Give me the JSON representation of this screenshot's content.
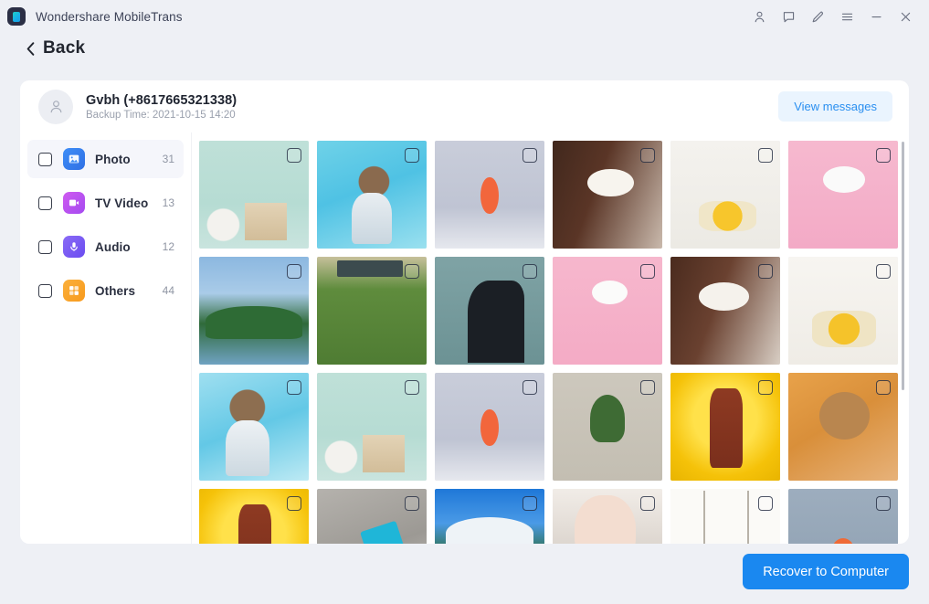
{
  "window": {
    "app_title": "Wondershare MobileTrans",
    "logo_icon": "wondershare-logo-icon",
    "controls": [
      {
        "name": "account-icon",
        "label": "Account"
      },
      {
        "name": "feedback-icon",
        "label": "Feedback"
      },
      {
        "name": "edit-icon",
        "label": "Edit"
      },
      {
        "name": "menu-icon",
        "label": "Menu"
      },
      {
        "name": "minimize-icon",
        "label": "Minimize"
      },
      {
        "name": "close-icon",
        "label": "Close"
      }
    ]
  },
  "nav": {
    "back_label": "Back",
    "back_icon": "chevron-left-icon"
  },
  "contact": {
    "avatar_icon": "person-icon",
    "name": "Gvbh (+8617665321338)",
    "backup_time": "Backup Time: 2021-10-15 14:20",
    "view_messages_label": "View messages"
  },
  "sidebar": {
    "items": [
      {
        "label": "Photo",
        "count": "31",
        "icon": "photo-icon",
        "icon_class": "photo",
        "active": true,
        "checked": false
      },
      {
        "label": "TV Video",
        "count": "13",
        "icon": "video-icon",
        "icon_class": "video",
        "active": false,
        "checked": false
      },
      {
        "label": "Audio",
        "count": "12",
        "icon": "audio-icon",
        "icon_class": "audio",
        "active": false,
        "checked": false
      },
      {
        "label": "Others",
        "count": "44",
        "icon": "others-icon",
        "icon_class": "others",
        "active": false,
        "checked": false
      }
    ]
  },
  "grid": {
    "columns": 6,
    "checkbox_icon": "checkbox-unchecked-icon",
    "tiles": [
      {
        "art": "a-room",
        "alt": "mint green room with chair and clock",
        "checked": false
      },
      {
        "art": "a-anime",
        "alt": "anime girl in water",
        "checked": false
      },
      {
        "art": "a-vase1",
        "alt": "orange flower in glass vase",
        "checked": false
      },
      {
        "art": "a-tulip",
        "alt": "white tulips in vase dark background",
        "checked": false
      },
      {
        "art": "a-yellow1",
        "alt": "yellow lilies with white pitcher",
        "checked": false
      },
      {
        "art": "a-pinkros",
        "alt": "white ranunculus on pink background",
        "checked": false
      },
      {
        "art": "a-beach",
        "alt": "tropical island with palm trees",
        "checked": false
      },
      {
        "art": "a-ivy",
        "alt": "green ivy covering wall",
        "checked": false
      },
      {
        "art": "a-man",
        "alt": "man in black shirt teal background",
        "checked": false
      },
      {
        "art": "a-pinkvase",
        "alt": "white flowers pink background",
        "checked": false
      },
      {
        "art": "a-whitefl",
        "alt": "white roses in vase",
        "checked": false
      },
      {
        "art": "a-yellow2",
        "alt": "yellow flowers with white jug",
        "checked": false
      },
      {
        "art": "a-anime2",
        "alt": "anime girl blue background",
        "checked": false
      },
      {
        "art": "a-room",
        "alt": "mint green room with chair and clock",
        "checked": false
      },
      {
        "art": "a-vase1",
        "alt": "orange flower in glass vase",
        "checked": false
      },
      {
        "art": "a-lily",
        "alt": "lily of the valley in glass vase",
        "checked": false
      },
      {
        "art": "a-singer",
        "alt": "singer on yellow stage",
        "checked": false
      },
      {
        "art": "a-dog",
        "alt": "poodle dog in pink jacket",
        "checked": false
      },
      {
        "art": "a-singer",
        "alt": "singer on yellow stage",
        "checked": false
      },
      {
        "art": "a-phone",
        "alt": "phone and cables on ground",
        "checked": false
      },
      {
        "art": "a-mountain",
        "alt": "mountain landscape with blue sky",
        "checked": false
      },
      {
        "art": "a-selfie",
        "alt": "close up portrait smiling",
        "checked": false
      },
      {
        "art": "a-lamps",
        "alt": "two hanging pendant lamps",
        "checked": false
      },
      {
        "art": "a-flowers2",
        "alt": "orange flower arrangement gray backdrop",
        "checked": false
      }
    ]
  },
  "footer": {
    "recover_label": "Recover to Computer"
  },
  "colors": {
    "accent": "#1a88f0",
    "page_background": "#eef0f5",
    "card_background": "#ffffff",
    "view_messages_bg": "#eaf4fe",
    "view_messages_text": "#2a8ff0"
  }
}
